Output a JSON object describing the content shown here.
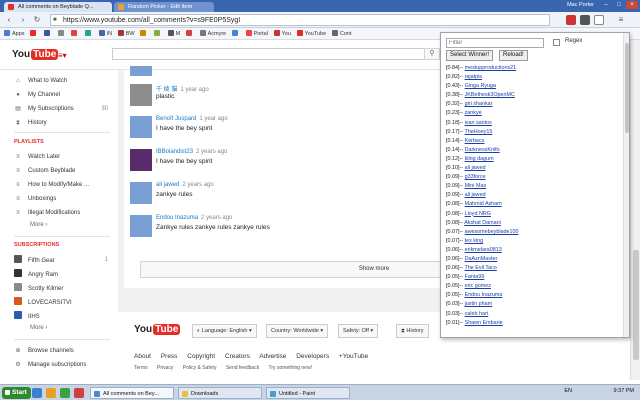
{
  "browser": {
    "tabs": [
      {
        "label": "All comments on Beyblade Q..."
      },
      {
        "label": "Random Picker - Edit Item"
      }
    ],
    "user": "Mac Porter",
    "url": "https://www.youtube.com/all_comments?v=s9FE0P5SygI"
  },
  "bookmarks": [
    "Apps",
    "",
    "",
    "",
    "",
    "",
    "IN",
    "BW",
    "",
    "",
    "M",
    "",
    "Acmyre",
    "",
    "Portal",
    "You",
    "YouTube",
    "Cont"
  ],
  "youtube": {
    "logo_you": "You",
    "logo_tube": "Tube",
    "sidebar": {
      "top_items": [
        {
          "label": "What to Watch",
          "icon": "home-icon"
        },
        {
          "label": "My Channel",
          "icon": "user-icon"
        },
        {
          "label": "My Subscriptions",
          "icon": "subscriptions-icon",
          "count": "30"
        },
        {
          "label": "History",
          "icon": "history-icon"
        }
      ],
      "playlists_heading": "PLAYLISTS",
      "playlists": [
        {
          "label": "Watch Later"
        },
        {
          "label": "Custom Beyblade"
        },
        {
          "label": "How to Modify/Make ..."
        },
        {
          "label": "Unboxings"
        },
        {
          "label": "Illegal Modifications"
        }
      ],
      "more1": "More ›",
      "subscriptions_heading": "SUBSCRIPTIONS",
      "subscriptions": [
        {
          "label": "Fifth Gear",
          "count": "1"
        },
        {
          "label": "Angry Ram"
        },
        {
          "label": "Scotty Kilmer"
        },
        {
          "label": "LOVECARSITVI"
        },
        {
          "label": "IIHS"
        }
      ],
      "more2": "More ›",
      "browse_channels": "Browse channels",
      "manage_subscriptions": "Manage subscriptions"
    },
    "comments": [
      {
        "user": "",
        "time": "",
        "text": ""
      },
      {
        "user": "千 绫 貓",
        "time": "1 year ago",
        "text": "plastic"
      },
      {
        "user": "Benoît Juspard",
        "time": "1 year ago",
        "text": "I have the bey spirit"
      },
      {
        "user": "IBBolandist23",
        "time": "2 years ago",
        "text": "I have the bey spirit"
      },
      {
        "user": "ali jawed",
        "time": "2 years ago",
        "text": "zankye rules"
      },
      {
        "user": "Endou Inazuma",
        "time": "2 years ago",
        "text": "Zankye rules zankye rules zankye rules"
      }
    ],
    "show_more": "Show more",
    "footer": {
      "language": "Language: English",
      "country": "Country: Worldwide",
      "safety": "Safety: Off",
      "history": "History",
      "links": [
        "About",
        "Press",
        "Copyright",
        "Creators",
        "Advertise",
        "Developers",
        "+YouTube"
      ],
      "links2": [
        "Terms",
        "Privacy",
        "Policy & Safety",
        "Send feedback",
        "Try something new!"
      ]
    }
  },
  "picker": {
    "filter_placeholder": "Filter",
    "regex_label": "Regex",
    "select_winner": "Select Winner!",
    "reload": "Reload!",
    "entries": [
      {
        "score": "[0.84]",
        "name": "mestupproductions21"
      },
      {
        "score": "[0.82]",
        "name": "rajatpis"
      },
      {
        "score": "[0.43]",
        "name": "Ginga Ryuga"
      },
      {
        "score": "[0.38]",
        "name": "JKBethesk3OpenMC"
      },
      {
        "score": "[0.32]",
        "name": "giri shankar"
      },
      {
        "score": "[0.23]",
        "name": "zankye"
      },
      {
        "score": "[0.18]",
        "name": "ivan santos"
      },
      {
        "score": "[0.17]",
        "name": "TheHoey15"
      },
      {
        "score": "[0.14]",
        "name": "Kerbecs"
      },
      {
        "score": "[0.14]",
        "name": "DarknessKnifo"
      },
      {
        "score": "[0.12]",
        "name": "kling dagum"
      },
      {
        "score": "[0.10]",
        "name": "ali jawed"
      },
      {
        "score": "[0.09]",
        "name": "g33force"
      },
      {
        "score": "[0.09]",
        "name": "Mini Max"
      },
      {
        "score": "[0.09]",
        "name": "ali jawed"
      },
      {
        "score": "[0.08]",
        "name": "Mahmid Asham"
      },
      {
        "score": "[0.08]",
        "name": "Lloyd NRG"
      },
      {
        "score": "[0.08]",
        "name": "Akshat Damani"
      },
      {
        "score": "[0.07]",
        "name": "awesomebeyblade100"
      },
      {
        "score": "[0.07]",
        "name": "tex king"
      },
      {
        "score": "[0.06]",
        "name": "erikmelara0813"
      },
      {
        "score": "[0.06]",
        "name": "DaAznMaster"
      },
      {
        "score": "[0.06]",
        "name": "The Evil Taco"
      },
      {
        "score": "[0.05]",
        "name": "Fanta99"
      },
      {
        "score": "[0.05]",
        "name": "eric gomez"
      },
      {
        "score": "[0.05]",
        "name": "Endou Inazuma"
      },
      {
        "score": "[0.03]",
        "name": "justin pham"
      },
      {
        "score": "[0.03]",
        "name": "caleb hart"
      },
      {
        "score": "[0.01]",
        "name": "Shawn Embarie"
      }
    ]
  },
  "taskbar": {
    "start": "Start",
    "tasks": [
      {
        "label": "All comments on Bey...",
        "active": true
      },
      {
        "label": "Downloads"
      },
      {
        "label": "Untitled - Paint"
      }
    ],
    "lang": "EN",
    "time": "9:37 PM"
  }
}
